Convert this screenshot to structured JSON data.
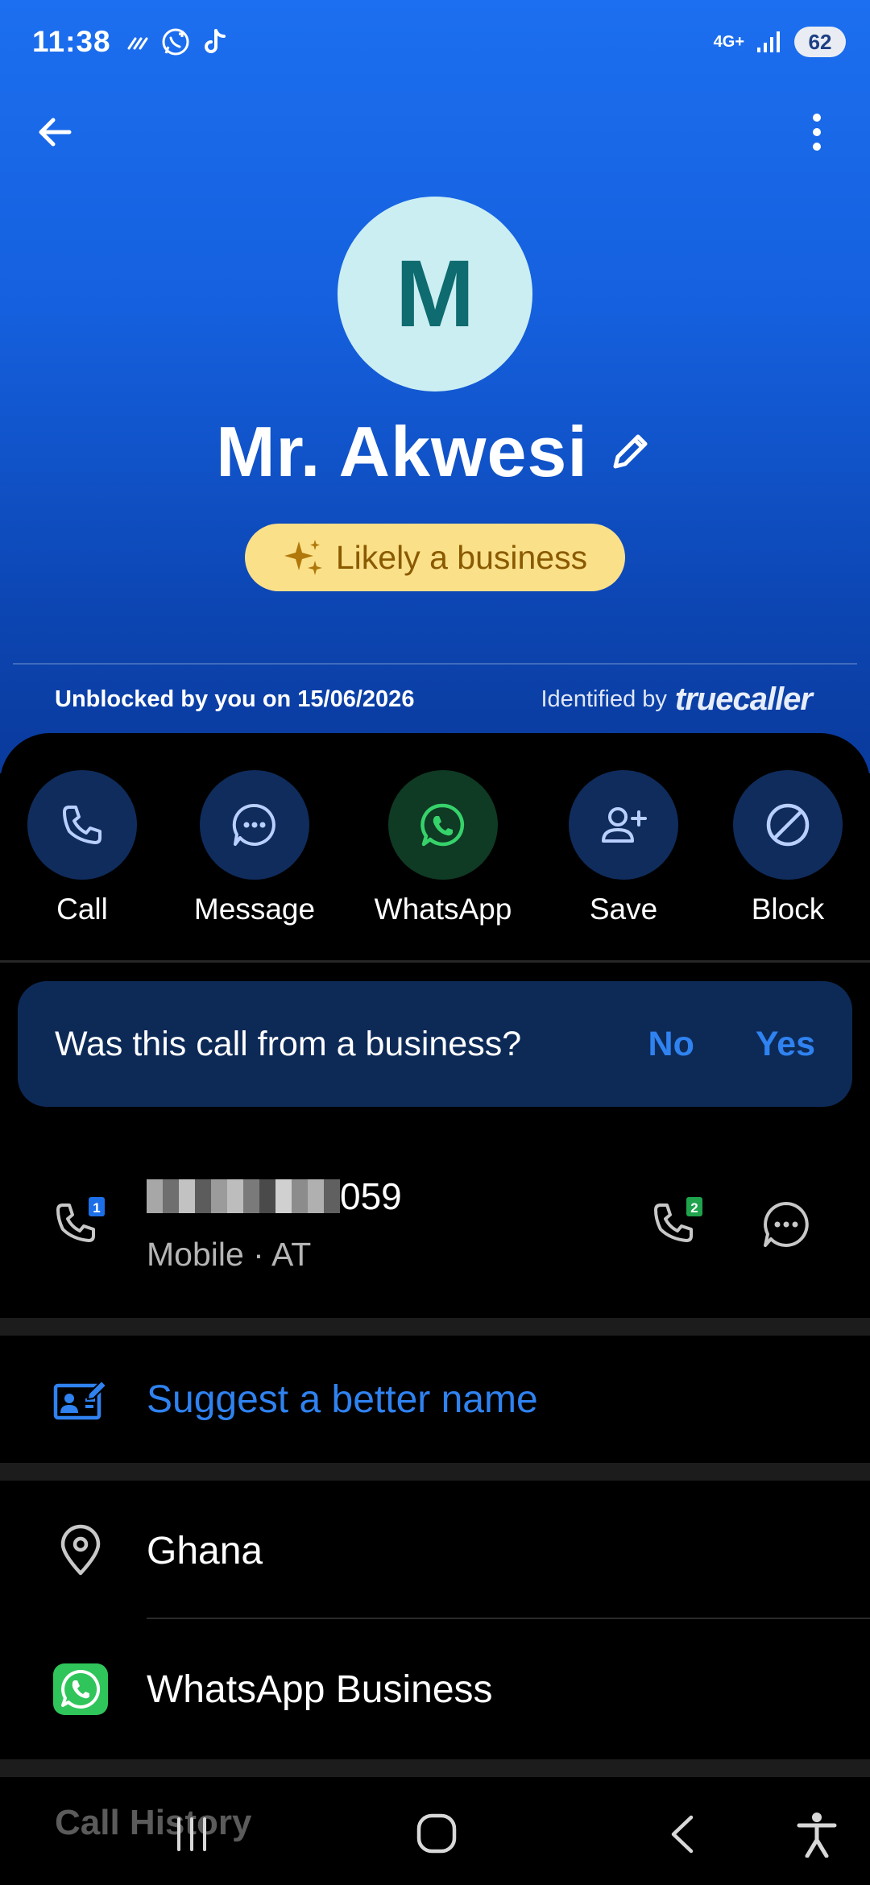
{
  "status_bar": {
    "time": "11:38",
    "network": "4G+",
    "battery": "62"
  },
  "contact": {
    "initial": "M",
    "name": "Mr. Akwesi",
    "badge": "Likely a business",
    "unblocked_text": "Unblocked by you on 15/06/2026",
    "identified_by": "Identified by",
    "brand": "truecaller"
  },
  "actions": [
    {
      "label": "Call",
      "icon": "phone-icon"
    },
    {
      "label": "Message",
      "icon": "chat-bubble-icon"
    },
    {
      "label": "WhatsApp",
      "icon": "whatsapp-icon"
    },
    {
      "label": "Save",
      "icon": "add-person-icon"
    },
    {
      "label": "Block",
      "icon": "block-icon"
    }
  ],
  "business_prompt": {
    "question": "Was this call from a business?",
    "no": "No",
    "yes": "Yes"
  },
  "phone": {
    "number_suffix": "059",
    "type": "Mobile · AT",
    "sim1": "1",
    "sim2": "2"
  },
  "suggest": {
    "label": "Suggest a better name"
  },
  "location": {
    "label": "Ghana"
  },
  "whatsapp_business": {
    "label": "WhatsApp Business"
  },
  "call_history": {
    "label": "Call History"
  },
  "colors": {
    "accent": "#2f82f0",
    "hero": "#1560de",
    "badge": "#fbe08a",
    "avatar": "#cbeef3"
  }
}
